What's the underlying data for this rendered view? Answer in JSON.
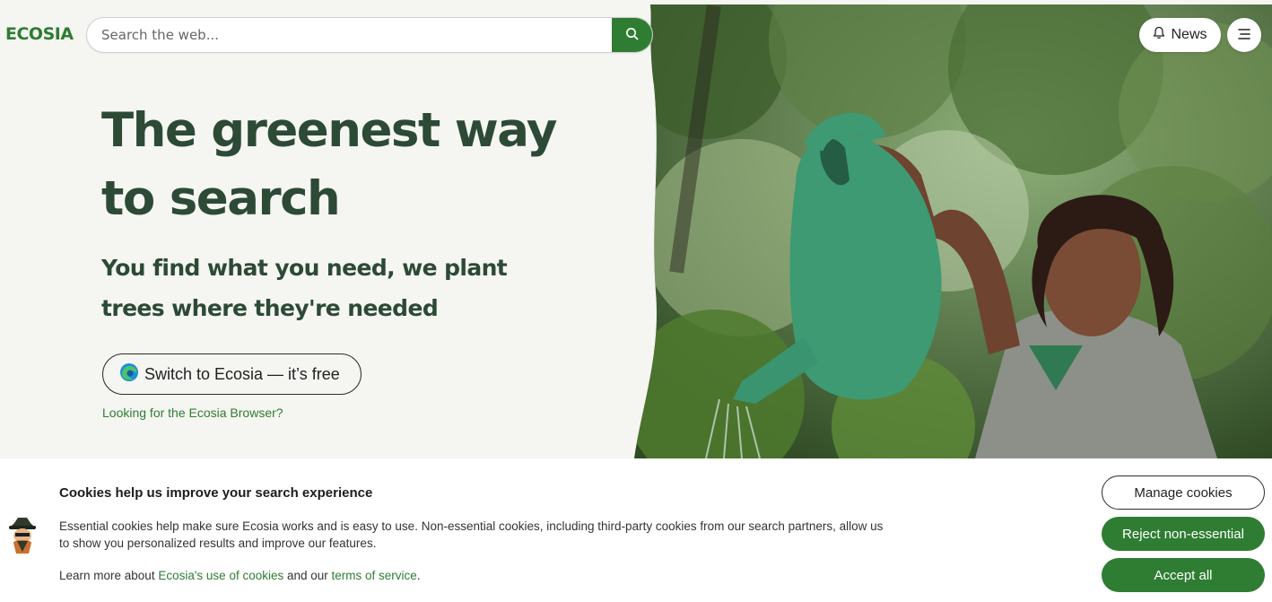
{
  "brand": {
    "logo_text": "ECOSIA",
    "accent_color": "#2e7d32",
    "heading_color": "#2c4a36"
  },
  "search": {
    "placeholder": "Search the web...",
    "value": "",
    "button_icon": "search-icon"
  },
  "header": {
    "news_label": "News",
    "news_icon": "bell-icon",
    "menu_icon": "hamburger-menu-icon"
  },
  "hero": {
    "headline_line1": "The greenest way",
    "headline_line2": "to search",
    "subline_line1": "You find what you need, we plant",
    "subline_line2": "trees where they're needed",
    "switch_button_label": "Switch to Ecosia — it’s free",
    "switch_button_icon": "edge-browser-icon",
    "browser_link": "Looking for the Ecosia Browser?",
    "photo_icon": "woman-watering-plants-photo"
  },
  "cookies": {
    "title": "Cookies help us improve your search experience",
    "text": "Essential cookies help make sure Ecosia works and is easy to use. Non-essential cookies, including third-party cookies from our search partners, allow us to show you personalized results and improve our features.",
    "learn_prefix": "Learn more about ",
    "learn_link1": "Ecosia's use of cookies",
    "learn_middle": " and our ",
    "learn_link2": "terms of service",
    "learn_suffix": ".",
    "avatar_icon": "cookie-mascot-icon",
    "manage_label": "Manage cookies",
    "reject_label": "Reject non-essential",
    "accept_label": "Accept all"
  }
}
